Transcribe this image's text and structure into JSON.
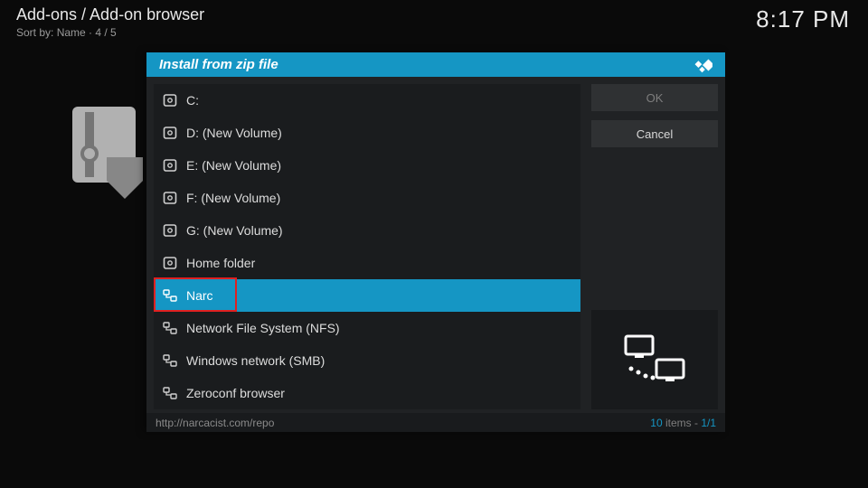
{
  "header": {
    "breadcrumb": "Add-ons / Add-on browser",
    "sort_prefix": "Sort by: ",
    "sort_field": "Name",
    "sort_sep": "  ·  ",
    "sort_pos": "4 / 5",
    "clock": "8:17 PM"
  },
  "dialog": {
    "title": "Install from zip file",
    "ok_label": "OK",
    "cancel_label": "Cancel",
    "items": [
      {
        "label": "C:",
        "icon": "drive"
      },
      {
        "label": "D: (New Volume)",
        "icon": "drive"
      },
      {
        "label": "E: (New Volume)",
        "icon": "drive"
      },
      {
        "label": "F: (New Volume)",
        "icon": "drive"
      },
      {
        "label": "G: (New Volume)",
        "icon": "drive"
      },
      {
        "label": "Home folder",
        "icon": "drive"
      },
      {
        "label": "Narc",
        "icon": "net"
      },
      {
        "label": "Network File System (NFS)",
        "icon": "net"
      },
      {
        "label": "Windows network (SMB)",
        "icon": "net"
      },
      {
        "label": "Zeroconf browser",
        "icon": "net"
      }
    ],
    "selected_index": 6,
    "footer_path": "http://narcacist.com/repo",
    "footer_count": "10",
    "footer_items_word": " items - ",
    "footer_page": "1/1"
  }
}
